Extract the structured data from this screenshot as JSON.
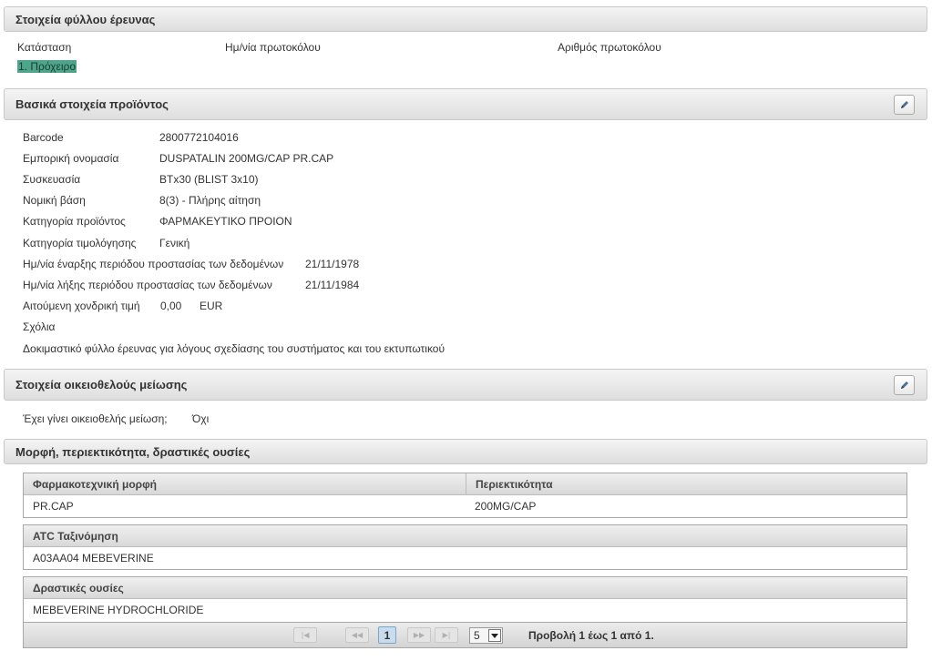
{
  "research_sheet": {
    "title": "Στοιχεία φύλλου έρευνας",
    "status_label": "Κατάσταση",
    "status_value": "1. Πρόχειρο",
    "protocol_date_label": "Ημ/νία πρωτοκόλου",
    "protocol_number_label": "Αριθμός πρωτοκόλου"
  },
  "product": {
    "title": "Βασικά στοιχεία προϊόντος",
    "barcode_label": "Barcode",
    "barcode_value": "2800772104016",
    "trade_name_label": "Εμπορική ονομασία",
    "trade_name_value": "DUSPATALIN 200MG/CAP PR.CAP",
    "packaging_label": "Συσκευασία",
    "packaging_value": "BTx30 (BLIST 3x10)",
    "legal_basis_label": "Νομική βάση",
    "legal_basis_value": "8(3) - Πλήρης αίτηση",
    "category_label": "Κατηγορία προϊόντος",
    "category_value": "ΦΑΡΜΑΚΕΥΤΙΚΟ ΠΡΟΙΟΝ",
    "pricing_category_label": "Κατηγορία τιμολόγησης",
    "pricing_category_value": "Γενική",
    "protection_start_label": "Ημ/νία έναρξης περιόδου προστασίας των δεδομένων",
    "protection_start_value": "21/11/1978",
    "protection_end_label": "Ημ/νία λήξης περιόδου προστασίας των δεδομένων",
    "protection_end_value": "21/11/1984",
    "wholesale_price_label": "Αιτούμενη χονδρική τιμή",
    "wholesale_price_value": "0,00",
    "currency": "EUR",
    "comments_label": "Σχόλια",
    "comments_value": "Δοκιμαστικό φύλλο έρευνας για λόγους σχεδίασης του συστήματος και του εκτυπωτικού"
  },
  "reduction": {
    "title": "Στοιχεία οικειοθελούς μείωσης",
    "question_label": "Έχει γίνει οικειοθελής μείωση;",
    "question_value": "Όχι"
  },
  "composition": {
    "title": "Μορφή, περιεκτικότητα, δραστικές ουσίες",
    "form_table": {
      "headers": [
        "Φαρμακοτεχνική μορφή",
        "Περιεκτικότητα"
      ],
      "rows": [
        [
          "PR.CAP",
          "200MG/CAP"
        ]
      ]
    },
    "atc_table": {
      "header": "ATC Ταξινόμηση",
      "rows": [
        "A03AA04 MEBEVERINE"
      ]
    },
    "substances_table": {
      "header": "Δραστικές ουσίες",
      "rows": [
        "MEBEVERINE HYDROCHLORIDE"
      ]
    }
  },
  "pager": {
    "first": "|◀",
    "prev": "◀◀",
    "current_page": "1",
    "next": "▶▶",
    "last": "▶|",
    "page_size": "5",
    "info": "Προβολή 1 έως 1 από 1."
  },
  "icons": {
    "edit": "pencil-icon",
    "dropdown": "chevron-down-icon"
  }
}
